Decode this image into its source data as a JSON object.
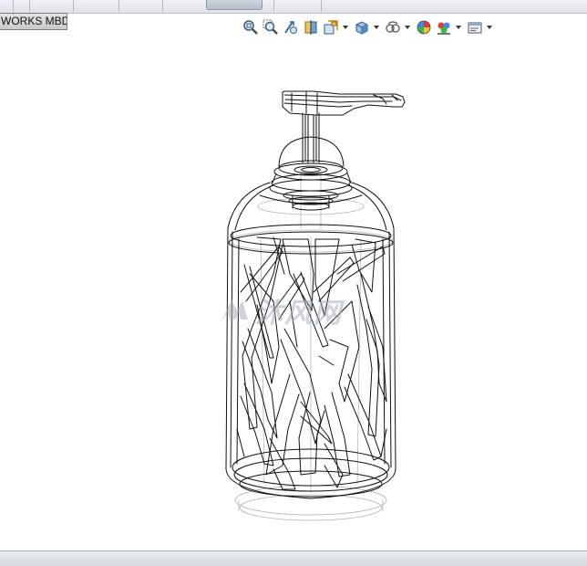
{
  "window": {
    "top_tab_text": "WORKS MBD"
  },
  "heads_up_toolbar": {
    "buttons": [
      {
        "icon": "zoom-to-fit-icon"
      },
      {
        "icon": "zoom-to-area-icon"
      },
      {
        "icon": "previous-view-icon"
      },
      {
        "icon": "section-view-icon"
      },
      {
        "icon": "dynamic-annotation-view-icon"
      },
      {
        "icon": "view-orientation-icon"
      },
      {
        "icon": "display-style-icon"
      },
      {
        "icon": "hide-show-items-icon"
      },
      {
        "icon": "edit-appearance-icon"
      },
      {
        "icon": "apply-scene-icon"
      },
      {
        "icon": "view-settings-icon"
      }
    ]
  },
  "watermark": {
    "text": "沐风网"
  },
  "colors": {
    "toolbar_bg": "#dfe3ea",
    "viewport_bg": "#ffffff",
    "model_lines": "#111111",
    "hidden_lines": "#b5b5b5",
    "watermark": "#a9b2bd"
  }
}
